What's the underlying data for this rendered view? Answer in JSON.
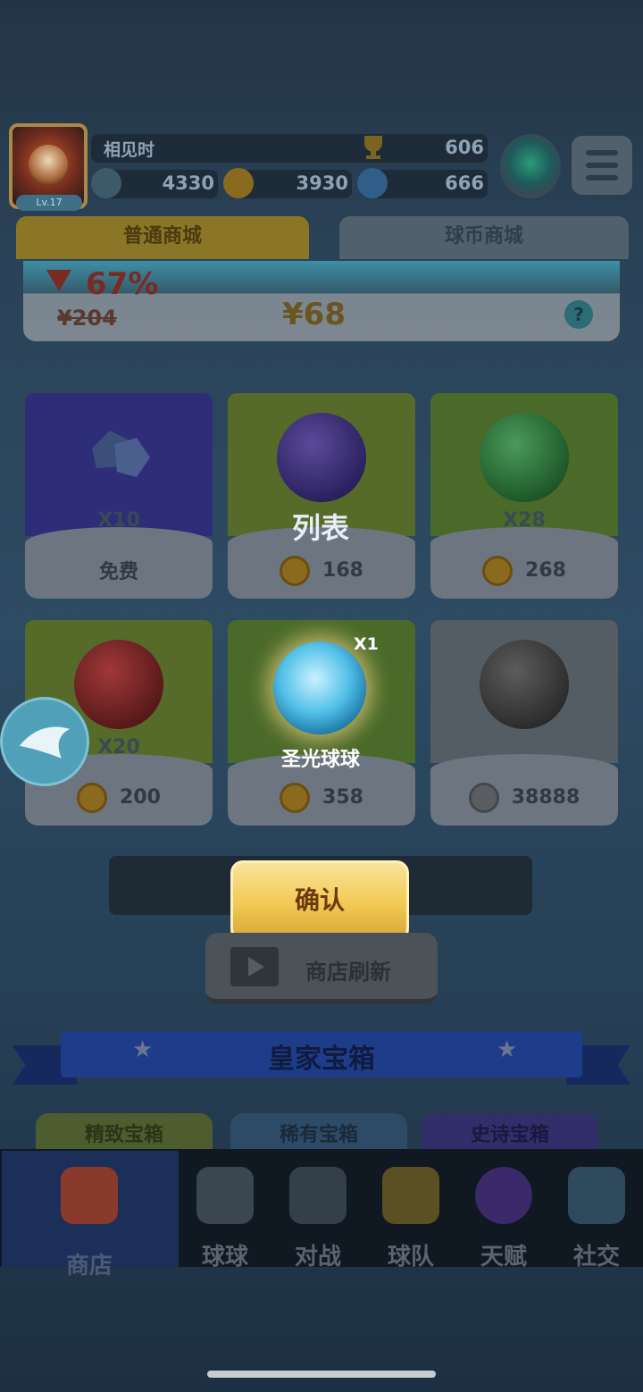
{
  "header": {
    "level": "Lv.17",
    "player_name": "相见时",
    "trophy_score": "606",
    "currencies": [
      "4330",
      "3930",
      "666"
    ],
    "menu_icon": "menu-icon",
    "rank_icon": "rank-badge-icon"
  },
  "tabs": [
    {
      "label": "普通商城",
      "active": true
    },
    {
      "label": "球币商城",
      "active": false
    }
  ],
  "banner": {
    "discount": "67%",
    "original_price": "¥204",
    "price": "¥68",
    "help": "?"
  },
  "shop_items": [
    {
      "qty": "X10",
      "cost": "免费",
      "icon": "diamond-icon",
      "color": "#2e2e78"
    },
    {
      "qty": "",
      "cost": "168",
      "icon": "clover-orb-icon",
      "color": "#566a2a"
    },
    {
      "qty": "X28",
      "cost": "268",
      "icon": "skull-orb-icon",
      "color": "#4a6a2a"
    },
    {
      "qty": "X20",
      "cost": "200",
      "icon": "fire-orb-icon",
      "color": "#566a2a"
    },
    {
      "qty": "",
      "cost": "358",
      "icon": "holy-light-orb-icon",
      "color": "#4a6a2a"
    },
    {
      "qty": "",
      "cost": "38888",
      "icon": "dark-orb-icon",
      "color": "#545c64"
    }
  ],
  "overlay": {
    "list_label": "列表",
    "item_name": "圣光球球",
    "item_qty": "X1",
    "confirm": "确认"
  },
  "refresh_label": "商店刷新",
  "royal_chest": {
    "title": "皇家宝箱",
    "tabs": [
      "精致宝箱",
      "稀有宝箱",
      "史诗宝箱"
    ]
  },
  "nav": [
    {
      "label": "商店",
      "icon": "shop-icon",
      "active": true
    },
    {
      "label": "球球",
      "icon": "balls-icon",
      "active": false
    },
    {
      "label": "对战",
      "icon": "swords-icon",
      "active": false
    },
    {
      "label": "球队",
      "icon": "whistle-icon",
      "active": false
    },
    {
      "label": "天赋",
      "icon": "talent-orb-icon",
      "active": false
    },
    {
      "label": "社交",
      "icon": "chat-heart-icon",
      "active": false
    }
  ]
}
